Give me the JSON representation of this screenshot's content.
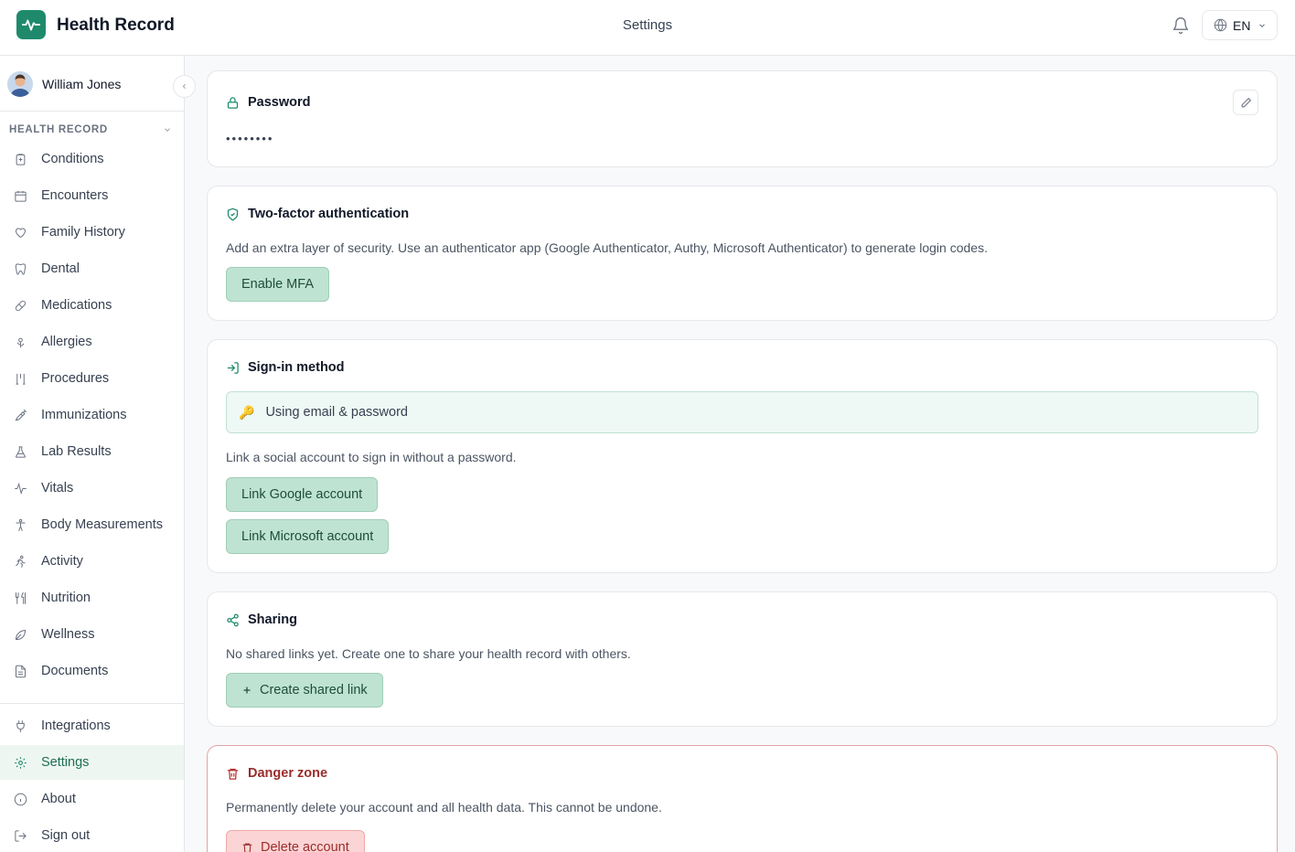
{
  "header": {
    "app_title": "Health Record",
    "page_title": "Settings",
    "language": "EN",
    "icons": [
      "heartbeat-logo-icon",
      "bell-icon",
      "globe-icon",
      "chevron-down-icon"
    ]
  },
  "sidebar": {
    "user_name": "William Jones",
    "section_label": "HEALTH RECORD",
    "items": [
      {
        "label": "Conditions",
        "icon": "clipboard-icon"
      },
      {
        "label": "Encounters",
        "icon": "calendar-icon"
      },
      {
        "label": "Family History",
        "icon": "heart-icon"
      },
      {
        "label": "Dental",
        "icon": "tooth-icon"
      },
      {
        "label": "Medications",
        "icon": "pill-icon"
      },
      {
        "label": "Allergies",
        "icon": "flower-icon"
      },
      {
        "label": "Procedures",
        "icon": "tools-icon"
      },
      {
        "label": "Immunizations",
        "icon": "syringe-icon"
      },
      {
        "label": "Lab Results",
        "icon": "flask-icon"
      },
      {
        "label": "Vitals",
        "icon": "pulse-icon"
      },
      {
        "label": "Body Measurements",
        "icon": "body-icon"
      },
      {
        "label": "Activity",
        "icon": "runner-icon"
      },
      {
        "label": "Nutrition",
        "icon": "utensils-icon"
      },
      {
        "label": "Wellness",
        "icon": "leaf-icon"
      },
      {
        "label": "Documents",
        "icon": "document-icon"
      }
    ],
    "footer_items": [
      {
        "label": "Integrations",
        "icon": "plug-icon"
      },
      {
        "label": "Settings",
        "icon": "gear-icon",
        "active": true
      },
      {
        "label": "About",
        "icon": "info-icon"
      },
      {
        "label": "Sign out",
        "icon": "sign-out-icon"
      }
    ]
  },
  "password": {
    "title": "Password",
    "value": "••••••••"
  },
  "mfa": {
    "title": "Two-factor authentication",
    "description": "Add an extra layer of security. Use an authenticator app (Google Authenticator, Authy, Microsoft Authenticator) to generate login codes.",
    "button": "Enable MFA"
  },
  "signin": {
    "title": "Sign-in method",
    "current_method": "Using email & password",
    "key_glyph": "🔑",
    "description": "Link a social account to sign in without a password.",
    "google_button": "Link Google account",
    "microsoft_button": "Link Microsoft account"
  },
  "sharing": {
    "title": "Sharing",
    "description": "No shared links yet. Create one to share your health record with others.",
    "button": "Create shared link"
  },
  "danger": {
    "title": "Danger zone",
    "description": "Permanently delete your account and all health data. This cannot be undone.",
    "button": "Delete account"
  },
  "colors": {
    "brand": "#1f8a6b",
    "button_green": "#bfe3d2",
    "danger_red": "#9b2c2c",
    "active_nav_bg": "#eef6f2"
  }
}
